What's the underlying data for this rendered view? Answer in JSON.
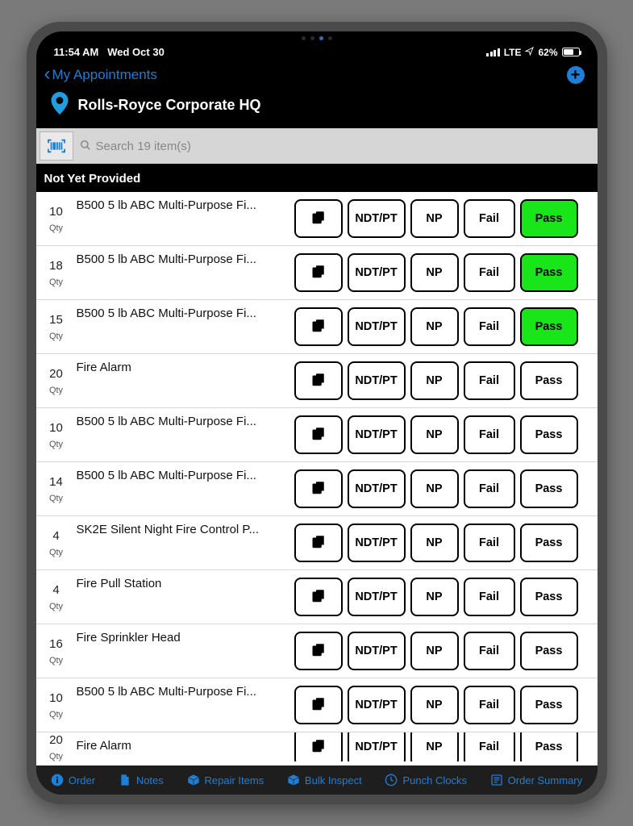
{
  "status": {
    "time": "11:54 AM",
    "date": "Wed Oct 30",
    "network": "LTE",
    "battery_pct": "62%"
  },
  "nav": {
    "back_label": "My Appointments"
  },
  "location": {
    "title": "Rolls-Royce Corporate HQ"
  },
  "search": {
    "placeholder": "Search 19 item(s)"
  },
  "section": {
    "header": "Not Yet Provided"
  },
  "qty_label": "Qty",
  "buttons": {
    "ndt": "NDT/PT",
    "np": "NP",
    "fail": "Fail",
    "pass": "Pass"
  },
  "items": [
    {
      "qty": "10",
      "name": "B500 5 lb ABC Multi-Purpose Fi...",
      "pass_active": true
    },
    {
      "qty": "18",
      "name": "B500 5 lb ABC Multi-Purpose Fi...",
      "pass_active": true
    },
    {
      "qty": "15",
      "name": "B500 5 lb ABC Multi-Purpose Fi...",
      "pass_active": true
    },
    {
      "qty": "20",
      "name": "Fire Alarm",
      "pass_active": false
    },
    {
      "qty": "10",
      "name": "B500 5 lb ABC Multi-Purpose Fi...",
      "pass_active": false
    },
    {
      "qty": "14",
      "name": "B500 5 lb ABC Multi-Purpose Fi...",
      "pass_active": false
    },
    {
      "qty": "4",
      "name": "SK2E Silent Night Fire Control P...",
      "pass_active": false
    },
    {
      "qty": "4",
      "name": "Fire Pull Station",
      "pass_active": false
    },
    {
      "qty": "16",
      "name": "Fire Sprinkler Head",
      "pass_active": false
    },
    {
      "qty": "10",
      "name": "B500 5 lb ABC Multi-Purpose Fi...",
      "pass_active": false
    },
    {
      "qty": "20",
      "name": "Fire Alarm",
      "pass_active": false
    }
  ],
  "toolbar": {
    "order": "Order",
    "notes": "Notes",
    "repair": "Repair Items",
    "bulk": "Bulk Inspect",
    "punch": "Punch Clocks",
    "summary": "Order Summary"
  }
}
